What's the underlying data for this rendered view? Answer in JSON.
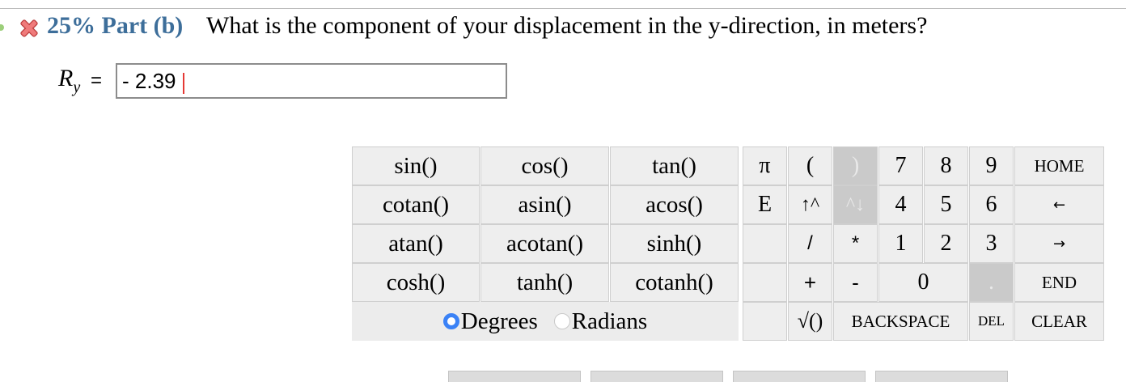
{
  "part": {
    "percent": "25%",
    "label": "Part (b)",
    "question": "What is the component of your displacement in the y-direction, in meters?"
  },
  "answer": {
    "var": "R",
    "sub": "y",
    "eq": "=",
    "value": "- 2.39"
  },
  "keypad": {
    "functions": [
      [
        "sin()",
        "cos()",
        "tan()"
      ],
      [
        "cotan()",
        "asin()",
        "acos()"
      ],
      [
        "atan()",
        "acotan()",
        "sinh()"
      ],
      [
        "cosh()",
        "tanh()",
        "cotanh()"
      ]
    ],
    "mode": {
      "degrees": "Degrees",
      "radians": "Radians",
      "selected": "Degrees"
    },
    "pi": "π",
    "e": "E",
    "open_paren": "(",
    "close_paren": ")",
    "up": "↑^",
    "down": "^↓",
    "slash": "/",
    "star": "*",
    "plus": "+",
    "minus": "-",
    "sqrt": "√()",
    "digits": {
      "d7": "7",
      "d8": "8",
      "d9": "9",
      "d4": "4",
      "d5": "5",
      "d6": "6",
      "d1": "1",
      "d2": "2",
      "d3": "3",
      "d0": "0"
    },
    "dot": ".",
    "backspace": "BACKSPACE",
    "del": "DEL",
    "home": "HOME",
    "left": "←",
    "right": "→",
    "end": "END",
    "clear": "CLEAR"
  },
  "colors": {
    "accent": "#3d6e9a",
    "error": "#e53935",
    "radio": "#3b82f6"
  }
}
